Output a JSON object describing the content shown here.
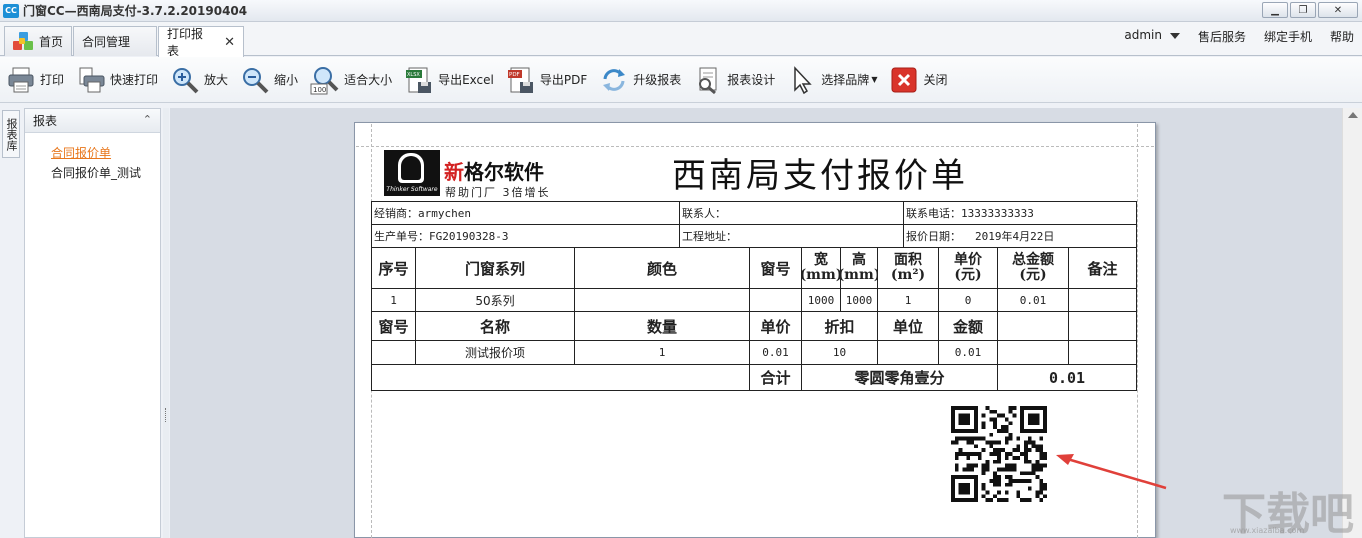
{
  "window": {
    "title": "门窗CC—西南局支付-3.7.2.20190404",
    "app_logo": "CC"
  },
  "tabs": [
    {
      "label": "首页"
    },
    {
      "label": "合同管理"
    },
    {
      "label": "打印报表"
    }
  ],
  "top_links": {
    "user": "admin",
    "after_sales": "售后服务",
    "bind_phone": "绑定手机",
    "help": "帮助"
  },
  "toolbar": [
    {
      "label": "打印",
      "icon": "printer-icon"
    },
    {
      "label": "快速打印",
      "icon": "quick-print-icon"
    },
    {
      "label": "放大",
      "icon": "zoom-in-icon"
    },
    {
      "label": "缩小",
      "icon": "zoom-out-icon"
    },
    {
      "label": "适合大小",
      "icon": "zoom-fit-icon"
    },
    {
      "label": "导出Excel",
      "icon": "xlsx-export-icon"
    },
    {
      "label": "导出PDF",
      "icon": "pdf-export-icon"
    },
    {
      "label": "升级报表",
      "icon": "refresh-icon"
    },
    {
      "label": "报表设计",
      "icon": "design-icon"
    },
    {
      "label": "选择品牌",
      "icon": "cursor-icon"
    },
    {
      "label": "关闭",
      "icon": "close-icon"
    }
  ],
  "left": {
    "vertical_tab": "报表库",
    "panel_title": "报表",
    "items": [
      "合同报价单",
      "合同报价单_测试"
    ]
  },
  "report": {
    "logo_text": "Thinker Software",
    "brand_first": "新",
    "brand_rest": "格尔软件",
    "tagline": "帮助门厂 3倍增长",
    "title": "西南局支付报价单",
    "info": {
      "dealer": "经销商：armychen",
      "contact": "联系人：",
      "phone": "联系电话：13333333333",
      "order_no": "生产单号：FG20190328-3",
      "site": "工程地址：",
      "quote_date_label": "报价日期：",
      "quote_date": "2019年4月22日"
    },
    "head1": {
      "seq": "序号",
      "series": "门窗系列",
      "color": "颜色",
      "win_no": "窗号",
      "width": "宽",
      "width_unit": "(mm)",
      "height": "高",
      "height_unit": "(mm)",
      "area": "面积",
      "area_unit": "(m²)",
      "price": "单价",
      "price_unit": "(元)",
      "total": "总金额",
      "total_unit": "(元)",
      "remark": "备注"
    },
    "row1": {
      "seq": "1",
      "series": "50系列",
      "color": "",
      "win_no": "",
      "width": "1000",
      "height": "1000",
      "area": "1",
      "price": "0",
      "total": "0.01",
      "remark": ""
    },
    "head2": {
      "win_no": "窗号",
      "name": "名称",
      "qty": "数量",
      "price": "单价",
      "discount": "折扣",
      "unit": "单位",
      "amount": "金额"
    },
    "row2": {
      "win_no": "",
      "name": "测试报价项",
      "qty": "1",
      "price": "0.01",
      "discount": "10",
      "unit": "",
      "amount": "0.01"
    },
    "sum": {
      "label": "合计",
      "words": "零圆零角壹分",
      "value": "0.01"
    }
  },
  "watermark": {
    "text": "下载吧",
    "url": "www.xiazaiba.com"
  }
}
